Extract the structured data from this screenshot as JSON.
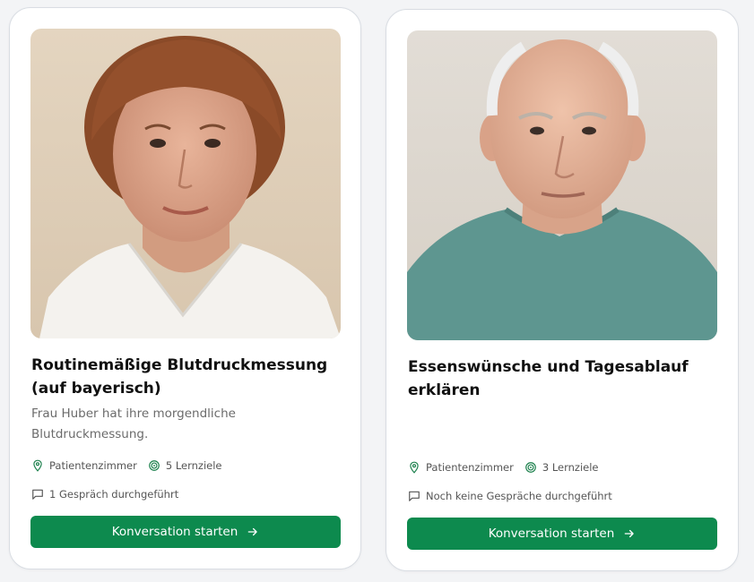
{
  "cards": [
    {
      "title": "Routinemäßige Blutdruckmessung (auf bayerisch)",
      "description": "Frau Huber hat ihre morgendliche Blutdruckmessung.",
      "location": "Patientenzimmer",
      "goals": "5 Lernziele",
      "conversations": "1 Gespräch durchgeführt",
      "button_label": "Konversation starten",
      "photo_icon": "elderly-woman-portrait"
    },
    {
      "title": "Essenswünsche und Tagesablauf erklären",
      "description": "",
      "location": "Patientenzimmer",
      "goals": "3 Lernziele",
      "conversations": "Noch keine Gespräche durchgeführt",
      "button_label": "Konversation starten",
      "photo_icon": "elderly-man-portrait"
    }
  ],
  "colors": {
    "accent": "#0d8a4e",
    "icon_green": "#1a7f4b",
    "muted_text": "#6b6b6b"
  }
}
